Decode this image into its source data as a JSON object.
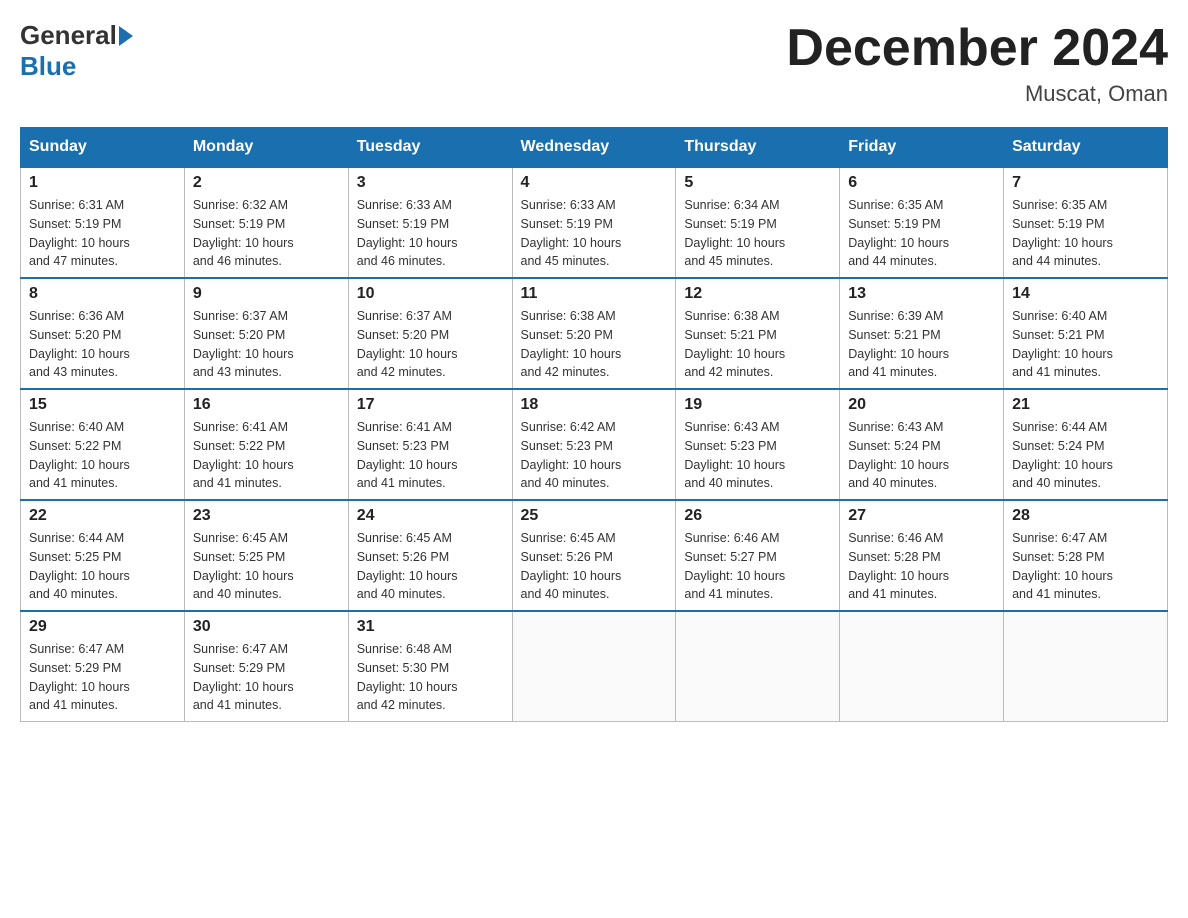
{
  "header": {
    "logo_general": "General",
    "logo_blue": "Blue",
    "month_title": "December 2024",
    "location": "Muscat, Oman"
  },
  "days_of_week": [
    "Sunday",
    "Monday",
    "Tuesday",
    "Wednesday",
    "Thursday",
    "Friday",
    "Saturday"
  ],
  "weeks": [
    [
      {
        "day": "1",
        "sunrise": "6:31 AM",
        "sunset": "5:19 PM",
        "daylight": "10 hours and 47 minutes."
      },
      {
        "day": "2",
        "sunrise": "6:32 AM",
        "sunset": "5:19 PM",
        "daylight": "10 hours and 46 minutes."
      },
      {
        "day": "3",
        "sunrise": "6:33 AM",
        "sunset": "5:19 PM",
        "daylight": "10 hours and 46 minutes."
      },
      {
        "day": "4",
        "sunrise": "6:33 AM",
        "sunset": "5:19 PM",
        "daylight": "10 hours and 45 minutes."
      },
      {
        "day": "5",
        "sunrise": "6:34 AM",
        "sunset": "5:19 PM",
        "daylight": "10 hours and 45 minutes."
      },
      {
        "day": "6",
        "sunrise": "6:35 AM",
        "sunset": "5:19 PM",
        "daylight": "10 hours and 44 minutes."
      },
      {
        "day": "7",
        "sunrise": "6:35 AM",
        "sunset": "5:19 PM",
        "daylight": "10 hours and 44 minutes."
      }
    ],
    [
      {
        "day": "8",
        "sunrise": "6:36 AM",
        "sunset": "5:20 PM",
        "daylight": "10 hours and 43 minutes."
      },
      {
        "day": "9",
        "sunrise": "6:37 AM",
        "sunset": "5:20 PM",
        "daylight": "10 hours and 43 minutes."
      },
      {
        "day": "10",
        "sunrise": "6:37 AM",
        "sunset": "5:20 PM",
        "daylight": "10 hours and 42 minutes."
      },
      {
        "day": "11",
        "sunrise": "6:38 AM",
        "sunset": "5:20 PM",
        "daylight": "10 hours and 42 minutes."
      },
      {
        "day": "12",
        "sunrise": "6:38 AM",
        "sunset": "5:21 PM",
        "daylight": "10 hours and 42 minutes."
      },
      {
        "day": "13",
        "sunrise": "6:39 AM",
        "sunset": "5:21 PM",
        "daylight": "10 hours and 41 minutes."
      },
      {
        "day": "14",
        "sunrise": "6:40 AM",
        "sunset": "5:21 PM",
        "daylight": "10 hours and 41 minutes."
      }
    ],
    [
      {
        "day": "15",
        "sunrise": "6:40 AM",
        "sunset": "5:22 PM",
        "daylight": "10 hours and 41 minutes."
      },
      {
        "day": "16",
        "sunrise": "6:41 AM",
        "sunset": "5:22 PM",
        "daylight": "10 hours and 41 minutes."
      },
      {
        "day": "17",
        "sunrise": "6:41 AM",
        "sunset": "5:23 PM",
        "daylight": "10 hours and 41 minutes."
      },
      {
        "day": "18",
        "sunrise": "6:42 AM",
        "sunset": "5:23 PM",
        "daylight": "10 hours and 40 minutes."
      },
      {
        "day": "19",
        "sunrise": "6:43 AM",
        "sunset": "5:23 PM",
        "daylight": "10 hours and 40 minutes."
      },
      {
        "day": "20",
        "sunrise": "6:43 AM",
        "sunset": "5:24 PM",
        "daylight": "10 hours and 40 minutes."
      },
      {
        "day": "21",
        "sunrise": "6:44 AM",
        "sunset": "5:24 PM",
        "daylight": "10 hours and 40 minutes."
      }
    ],
    [
      {
        "day": "22",
        "sunrise": "6:44 AM",
        "sunset": "5:25 PM",
        "daylight": "10 hours and 40 minutes."
      },
      {
        "day": "23",
        "sunrise": "6:45 AM",
        "sunset": "5:25 PM",
        "daylight": "10 hours and 40 minutes."
      },
      {
        "day": "24",
        "sunrise": "6:45 AM",
        "sunset": "5:26 PM",
        "daylight": "10 hours and 40 minutes."
      },
      {
        "day": "25",
        "sunrise": "6:45 AM",
        "sunset": "5:26 PM",
        "daylight": "10 hours and 40 minutes."
      },
      {
        "day": "26",
        "sunrise": "6:46 AM",
        "sunset": "5:27 PM",
        "daylight": "10 hours and 41 minutes."
      },
      {
        "day": "27",
        "sunrise": "6:46 AM",
        "sunset": "5:28 PM",
        "daylight": "10 hours and 41 minutes."
      },
      {
        "day": "28",
        "sunrise": "6:47 AM",
        "sunset": "5:28 PM",
        "daylight": "10 hours and 41 minutes."
      }
    ],
    [
      {
        "day": "29",
        "sunrise": "6:47 AM",
        "sunset": "5:29 PM",
        "daylight": "10 hours and 41 minutes."
      },
      {
        "day": "30",
        "sunrise": "6:47 AM",
        "sunset": "5:29 PM",
        "daylight": "10 hours and 41 minutes."
      },
      {
        "day": "31",
        "sunrise": "6:48 AM",
        "sunset": "5:30 PM",
        "daylight": "10 hours and 42 minutes."
      },
      null,
      null,
      null,
      null
    ]
  ],
  "labels": {
    "sunrise": "Sunrise:",
    "sunset": "Sunset:",
    "daylight": "Daylight:"
  }
}
